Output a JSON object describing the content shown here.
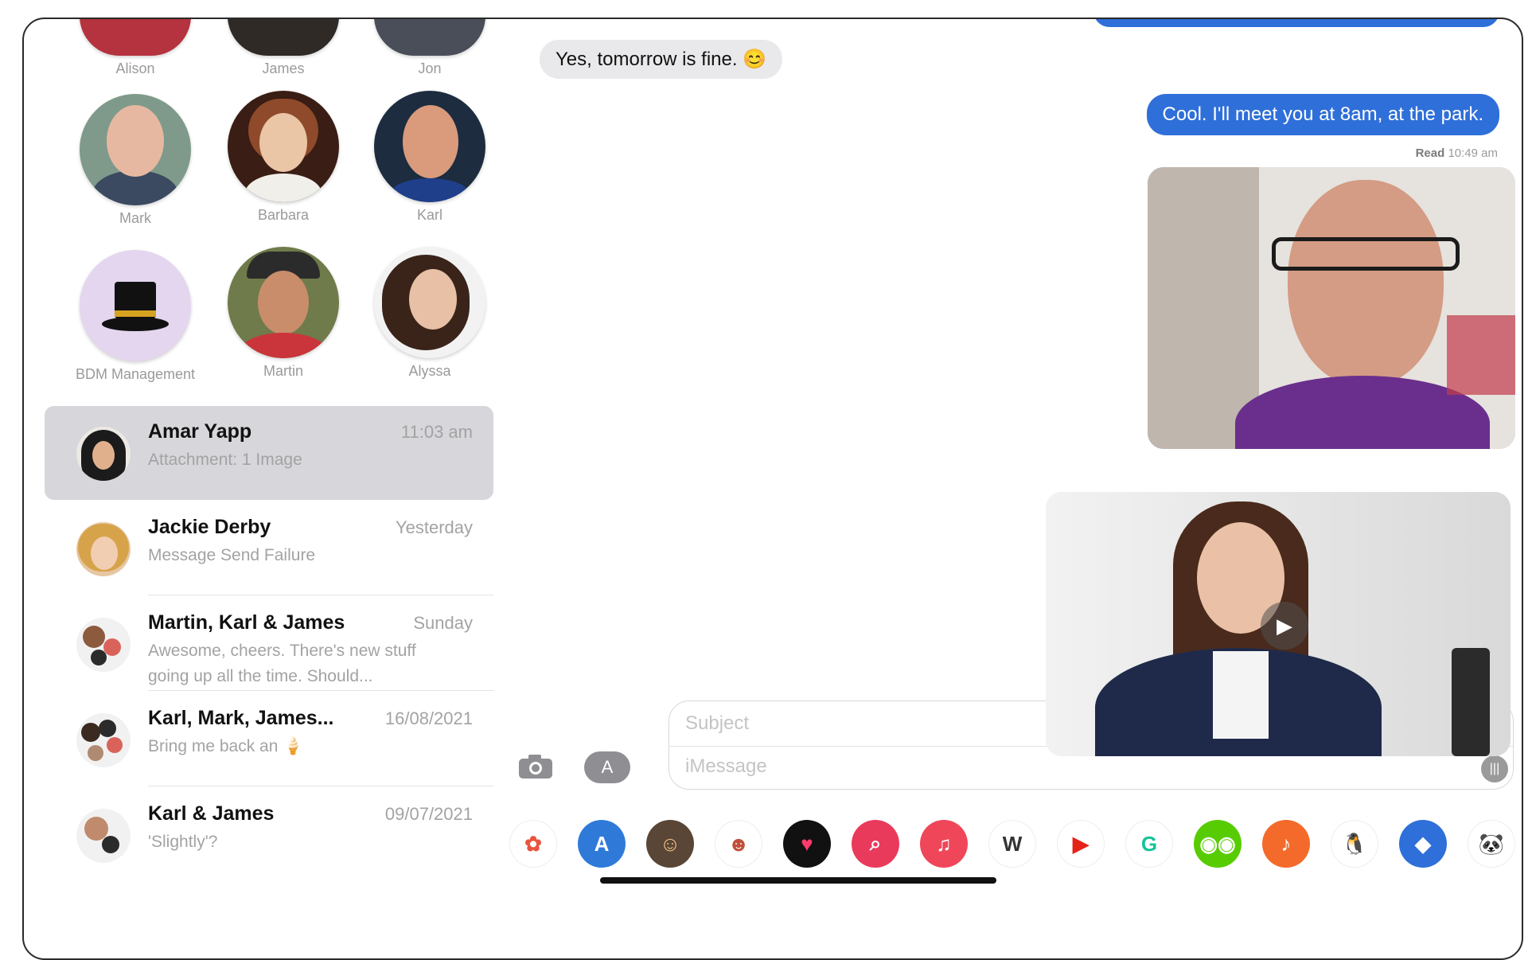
{
  "pinned_partial": [
    {
      "name": "Alison"
    },
    {
      "name": "James"
    },
    {
      "name": "Jon"
    }
  ],
  "pinned": [
    {
      "name": "Mark"
    },
    {
      "name": "Barbara"
    },
    {
      "name": "Karl"
    },
    {
      "name": "BDM Management"
    },
    {
      "name": "Martin"
    },
    {
      "name": "Alyssa"
    }
  ],
  "conversations": [
    {
      "name": "Amar Yapp",
      "time": "11:03 am",
      "preview": "Attachment: 1 Image",
      "selected": true
    },
    {
      "name": "Jackie Derby",
      "time": "Yesterday",
      "preview": "Message Send Failure"
    },
    {
      "name": "Martin, Karl & James",
      "time": "Sunday",
      "preview": "Awesome, cheers. There's new stuff going up all the time. Should..."
    },
    {
      "name": "Karl, Mark, James...",
      "time": "16/08/2021",
      "preview": "Bring me back an 🍦"
    },
    {
      "name": "Karl & James",
      "time": "09/07/2021",
      "preview": "'Slightly'?"
    }
  ],
  "chat": {
    "incoming": "Yes, tomorrow is fine. 😊",
    "outgoing": "Cool. I'll meet you at 8am, at the park.",
    "read_label": "Read",
    "read_time": "10:49 am",
    "play_icon": "play-icon"
  },
  "composer": {
    "subject_placeholder": "Subject",
    "message_placeholder": "iMessage"
  },
  "app_strip": [
    {
      "name": "photos-app-icon",
      "glyph": "✿",
      "bg": "#ffffff",
      "fg": "#e8553e"
    },
    {
      "name": "app-store-icon",
      "glyph": "A",
      "bg": "#2f7ad9",
      "fg": "#ffffff"
    },
    {
      "name": "memoji-icon",
      "glyph": "☺",
      "bg": "#5a4636",
      "fg": "#f3c28a"
    },
    {
      "name": "memoji-stickers-icon",
      "glyph": "☻",
      "bg": "#ffffff",
      "fg": "#c0503a"
    },
    {
      "name": "digital-touch-icon",
      "glyph": "♥",
      "bg": "#111111",
      "fg": "#ff3b6b"
    },
    {
      "name": "images-search-icon",
      "glyph": "⌕",
      "bg": "#ea3a5c",
      "fg": "#ffffff"
    },
    {
      "name": "music-app-icon",
      "glyph": "♫",
      "bg": "#f0465a",
      "fg": "#ffffff"
    },
    {
      "name": "wikipedia-icon",
      "glyph": "W",
      "bg": "#ffffff",
      "fg": "#333333"
    },
    {
      "name": "youtube-icon",
      "glyph": "▶",
      "bg": "#ffffff",
      "fg": "#e62117"
    },
    {
      "name": "grammarly-icon",
      "glyph": "G",
      "bg": "#ffffff",
      "fg": "#15c39a"
    },
    {
      "name": "duolingo-icon",
      "glyph": "◉◉",
      "bg": "#58cc02",
      "fg": "#ffffff"
    },
    {
      "name": "garageband-icon",
      "glyph": "♪",
      "bg": "#f46a2b",
      "fg": "#ffffff"
    },
    {
      "name": "penguin-sticker-icon",
      "glyph": "🐧",
      "bg": "#ffffff",
      "fg": "#333333"
    },
    {
      "name": "dropbox-icon",
      "glyph": "◆",
      "bg": "#2f6fd9",
      "fg": "#ffffff"
    },
    {
      "name": "panda-sticker-icon",
      "glyph": "🐼",
      "bg": "#ffffff",
      "fg": "#333333"
    }
  ]
}
